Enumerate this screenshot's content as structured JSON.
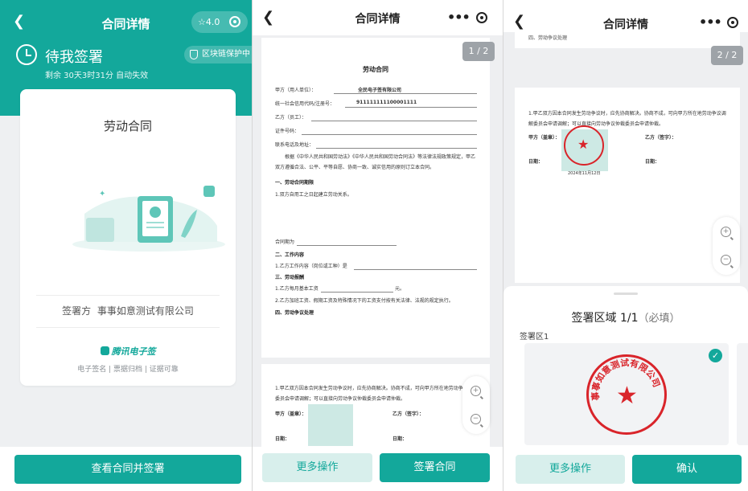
{
  "panel1": {
    "header": {
      "title": "合同详情",
      "rating": "4.0",
      "rating_icon": "star-icon"
    },
    "status": {
      "title": "待我签署",
      "remaining": "剩余 30天3时31分 自动失效",
      "blockchain": "区块链保护中"
    },
    "card": {
      "contract_name": "劳动合同",
      "signer_label": "签署方",
      "signer_name": "事事如意测试有限公司",
      "brand": "腾讯电子签",
      "tagline": "电子签名 | 票据归档 | 证据可靠"
    },
    "button": "查看合同并签署"
  },
  "panel2": {
    "header": {
      "title": "合同详情"
    },
    "page_indicator": "1 / 2",
    "doc": {
      "title": "劳动合同",
      "party_a_label": "甲方（用人单位）：",
      "party_a_value": "全民电子签有限公司",
      "credit_label": "统一社会信用代码/注册号：",
      "credit_value": "911111111100001111",
      "party_b_label": "乙方（员工）：",
      "id_label": "证件号码：",
      "phone_label": "联系电话及地址：",
      "intro": "根据《中华人民共和国劳动法》《中华人民共和国劳动合同法》等法律法规政策规定，甲乙双方遵循合法、公平、平等自愿、协商一致、诚实信用的原则订立本合同。",
      "s1": "一、劳动合同期限",
      "s1_1": "1.双方自用工之日起建立劳动关系。",
      "term": "合同期为",
      "s2": "二、工作内容",
      "s2_1": "1.乙方工作内容（岗位或工种）是",
      "s3": "三、劳动报酬",
      "s3_1": "1.乙方每月基本工资",
      "s3_1_unit": "元。",
      "s3_2": "2.乙方加班工资、假期工资及特殊情况下的工资支付按有关法律、法规的规定执行。",
      "s4": "四、劳动争议处理",
      "p2_text": "1.甲乙双方因本合同发生劳动争议时，应先协商解决。协商不成，可向甲方所在地劳动争议调解委员会申请调解；可以直接向劳动争议仲裁委员会申请仲裁。",
      "p2_party_a": "甲方（盖章）：",
      "p2_party_b": "乙方（签字）：",
      "p2_date_a": "日期：",
      "p2_date_b": "日期："
    },
    "buttons": {
      "more": "更多操作",
      "sign": "签署合同"
    }
  },
  "panel3": {
    "header": {
      "title": "合同详情"
    },
    "page_indicator": "2 / 2",
    "doc": {
      "top_cut": "四、劳动争议处理",
      "text": "1.甲乙双方因本合同发生劳动争议时，应先协商解决。协商不成，可向甲方所在地劳动争议调解委员会申请调解；可以直接向劳动争议仲裁委员会申请仲裁。",
      "party_a": "甲方（盖章）：",
      "party_b": "乙方（签字）：",
      "date_a": "日期：",
      "date_b": "日期：",
      "seal_date": "2024年11月12日"
    },
    "sign_area": {
      "title": "签署区域 1/1",
      "required": "（必填）",
      "label": "签署区1",
      "seal_text": "事事如意测试有限公司"
    },
    "buttons": {
      "more": "更多操作",
      "confirm": "确认"
    }
  },
  "colors": {
    "brand": "#13a89b",
    "seal": "#d9242a"
  }
}
